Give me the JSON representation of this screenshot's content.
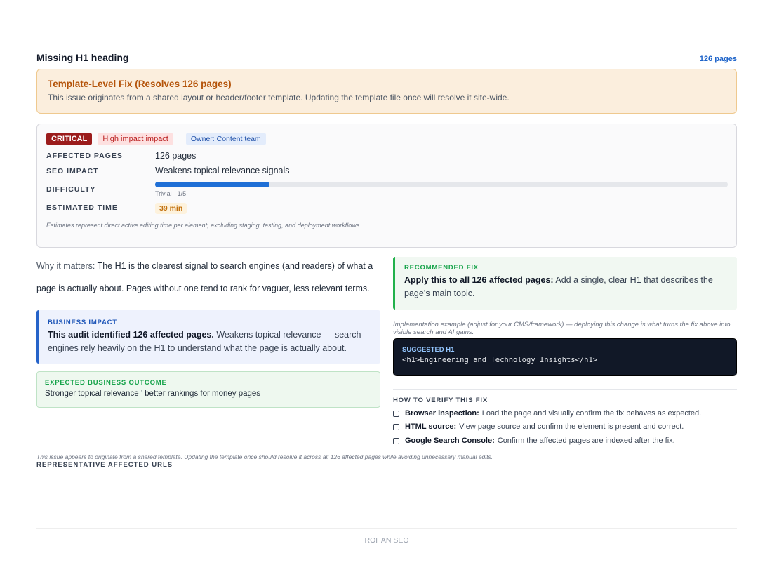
{
  "issue": {
    "title": "Missing H1 heading",
    "pages_link": "126 pages"
  },
  "template_fix": {
    "title": "Template-Level Fix (Resolves 126 pages)",
    "description": "This issue originates from a shared layout or header/footer template. Updating the template file once will resolve it site-wide."
  },
  "details": {
    "badge_critical": "CRITICAL",
    "badge_impact": "High impact impact",
    "badge_owner": "Owner: Content team",
    "affected_pages_label": "AFFECTED PAGES",
    "affected_pages_value": "126 pages",
    "seo_impact_label": "SEO IMPACT",
    "seo_impact_value": "Weakens topical relevance signals",
    "difficulty_label": "DIFFICULTY",
    "difficulty_caption": "Trivial · 1/5",
    "difficulty_level": 0.2,
    "estimated_time_label": "ESTIMATED TIME",
    "estimated_time_value": "39 min",
    "estimate_note": "Estimates represent direct active editing time per element, excluding staging, testing, and deployment workflows."
  },
  "why": {
    "label": "Why it matters:",
    "text": "The H1 is the clearest signal to search engines (and readers) of what a page is actually about. Pages without one tend to rank for vaguer, less relevant terms."
  },
  "business_impact": {
    "kicker": "BUSINESS IMPACT",
    "strong": "This audit identified 126 affected pages.",
    "text": "Weakens topical relevance — search engines rely heavily on the H1 to understand what the page is actually about."
  },
  "outcome": {
    "kicker": "EXPECTED BUSINESS OUTCOME",
    "text": "Stronger topical relevance ’ better rankings for money pages"
  },
  "recommended": {
    "kicker": "RECOMMENDED FIX",
    "strong": "Apply this to all 126 affected pages:",
    "text": "Add a single, clear H1 that describes the page’s main topic."
  },
  "implementation": {
    "note": "Implementation example (adjust for your CMS/framework) — deploying this change is what turns the fix above into visible search and AI gains.",
    "code_label": "SUGGESTED H1",
    "code": "<h1>Engineering and Technology Insights</h1>"
  },
  "verify": {
    "title": "HOW TO VERIFY THIS FIX",
    "items": [
      {
        "strong": "Browser inspection:",
        "text": "Load the page and visually confirm the fix behaves as expected."
      },
      {
        "strong": "HTML source:",
        "text": "View page source and confirm the element is present and correct."
      },
      {
        "strong": "Google Search Console:",
        "text": "Confirm the affected pages are indexed after the fix."
      }
    ]
  },
  "footer_section": {
    "template_note": "This issue appears to originate from a shared template. Updating the template once should resolve it across all 126 affected pages while avoiding unnecessary manual edits.",
    "urls_heading": "REPRESENTATIVE AFFECTED URLS"
  },
  "brand": "ROHAN SEO"
}
